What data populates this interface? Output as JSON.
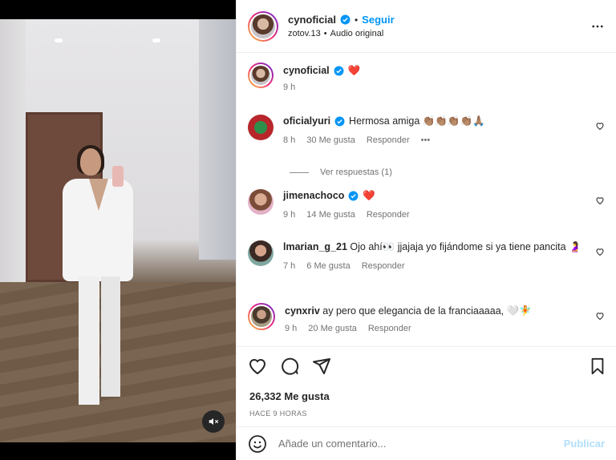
{
  "post": {
    "author": "cynoficial",
    "separator": "•",
    "follow_label": "Seguir",
    "audio_user": "zotov.13",
    "audio_sep": "•",
    "audio_label": "Audio original",
    "caption_emoji": "❤️",
    "caption_time": "9 h",
    "likes_label": "26,332 Me gusta",
    "time_ago": "HACE 9 HORAS"
  },
  "comments": [
    {
      "user": "oficialyuri",
      "text": "Hermosa amiga 👏🏽👏🏽👏🏽👏🏽🙏🏽",
      "time": "8 h",
      "likes": "30 Me gusta",
      "reply": "Responder",
      "more": "•••"
    },
    {
      "user": "jimenachoco",
      "text": "❤️",
      "time": "9 h",
      "likes": "14 Me gusta",
      "reply": "Responder"
    },
    {
      "user": "lmarian_g_21",
      "text": "Ojo ahí👀 jjajaja yo fijándome si ya tiene pancita 🤰",
      "time": "7 h",
      "likes": "6 Me gusta",
      "reply": "Responder"
    },
    {
      "user": "cynxriv",
      "text": "ay pero que elegancia de la franciaaaaa, 🤍🧚",
      "time": "9 h",
      "likes": "20 Me gusta",
      "reply": "Responder"
    }
  ],
  "view_replies": "Ver respuestas (1)",
  "composer": {
    "placeholder": "Añade un comentario...",
    "publish_label": "Publicar"
  },
  "colors": {
    "accent": "#0095f6",
    "verified": "#0095f6",
    "heart": "#ed4956",
    "publish_disabled": "#b2dffc"
  }
}
